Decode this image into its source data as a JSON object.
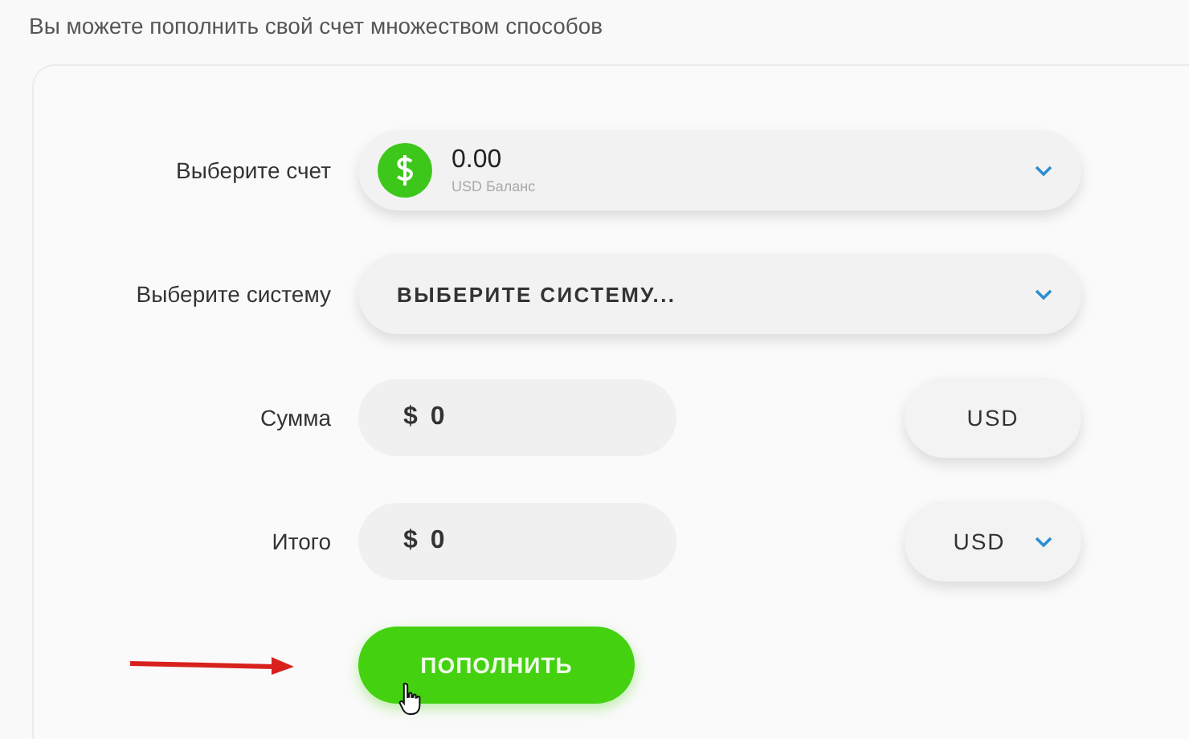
{
  "intro": "Вы можете пополнить свой счет множеством способов",
  "rows": [
    {
      "kind": "account",
      "label": "Выберите счет",
      "value": "0.00",
      "caption": "USD Баланс"
    },
    {
      "kind": "select",
      "label": "Выберите систему",
      "value": "ВЫБЕРИТЕ СИСТЕМУ..."
    },
    {
      "kind": "amount",
      "label": "Сумма",
      "symbol": "$",
      "value": "0",
      "currency": {
        "label": "USD",
        "dropdown": false
      }
    },
    {
      "kind": "amount",
      "label": "Итого",
      "symbol": "$",
      "value": "0",
      "currency": {
        "label": "USD",
        "dropdown": true
      }
    }
  ],
  "submit": "ПОПОЛНИТЬ"
}
